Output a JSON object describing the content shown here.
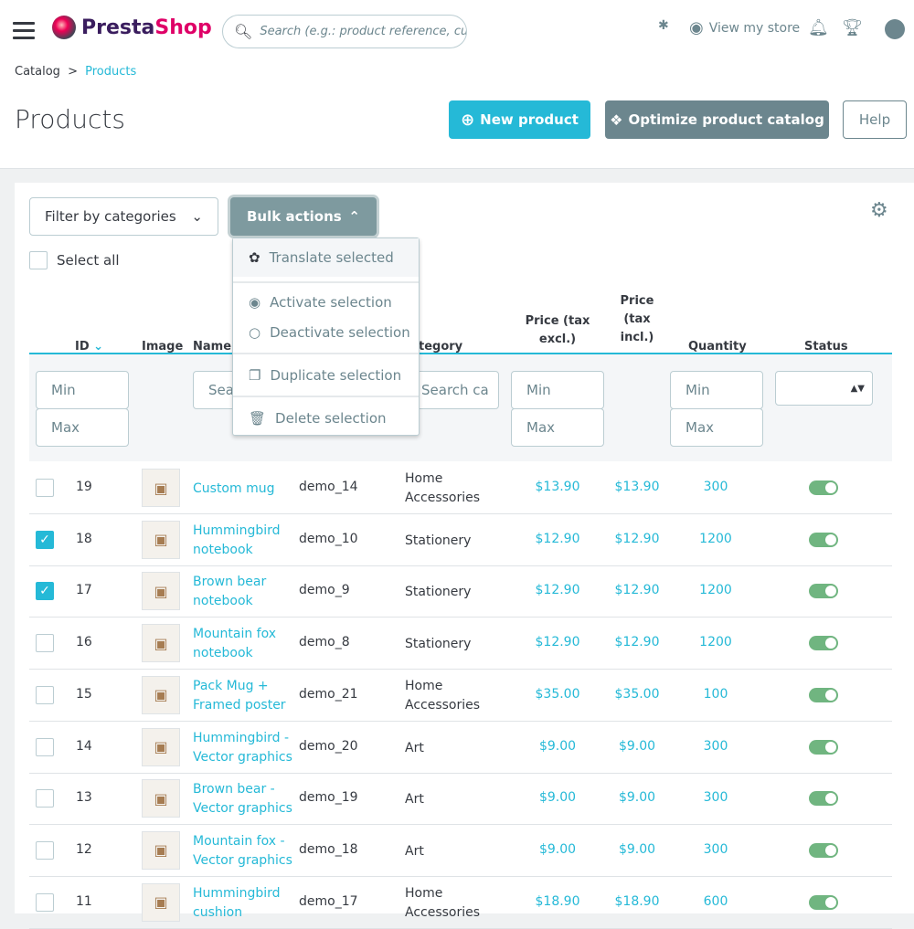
{
  "header": {
    "brand": "PrestaShop",
    "brand_part1": "Presta",
    "brand_part2": "Shop",
    "search_placeholder": "Search (e.g.: product reference, custon",
    "view_store": "View my store"
  },
  "breadcrumb": {
    "parent": "Catalog",
    "separator": ">",
    "current": "Products"
  },
  "page": {
    "title": "Products",
    "new_product": "New product",
    "optimize": "Optimize product catalog",
    "help": "Help"
  },
  "toolbar": {
    "filter_categories": "Filter by categories",
    "bulk_actions": "Bulk actions",
    "select_all": "Select all"
  },
  "bulk_menu": [
    "Translate selected",
    "Activate selection",
    "Deactivate selection",
    "Duplicate selection",
    "Delete selection"
  ],
  "columns": {
    "id": "ID",
    "image": "Image",
    "name": "Name",
    "category": "tegory",
    "price_excl": "Price (tax excl.)",
    "price_incl": "Price (tax incl.)",
    "quantity": "Quantity",
    "status": "Status"
  },
  "filters": {
    "min": "Min",
    "max": "Max",
    "name_search": "Sea",
    "category_search": "Search ca"
  },
  "colors": {
    "accent": "#25b9d7",
    "toggle_on": "#70b580",
    "bulk": "#7e9a9f"
  },
  "rows": [
    {
      "checked": false,
      "id": "19",
      "name": "Custom mug",
      "ref": "demo_14",
      "category": "Home Accessories",
      "excl": "$13.90",
      "incl": "$13.90",
      "qty": "300",
      "active": true
    },
    {
      "checked": true,
      "id": "18",
      "name": "Hummingbird notebook",
      "ref": "demo_10",
      "category": "Stationery",
      "excl": "$12.90",
      "incl": "$12.90",
      "qty": "1200",
      "active": true
    },
    {
      "checked": true,
      "id": "17",
      "name": "Brown bear notebook",
      "ref": "demo_9",
      "category": "Stationery",
      "excl": "$12.90",
      "incl": "$12.90",
      "qty": "1200",
      "active": true
    },
    {
      "checked": false,
      "id": "16",
      "name": "Mountain fox notebook",
      "ref": "demo_8",
      "category": "Stationery",
      "excl": "$12.90",
      "incl": "$12.90",
      "qty": "1200",
      "active": true
    },
    {
      "checked": false,
      "id": "15",
      "name": "Pack Mug + Framed poster",
      "ref": "demo_21",
      "category": "Home Accessories",
      "excl": "$35.00",
      "incl": "$35.00",
      "qty": "100",
      "active": true
    },
    {
      "checked": false,
      "id": "14",
      "name": "Hummingbird - Vector graphics",
      "ref": "demo_20",
      "category": "Art",
      "excl": "$9.00",
      "incl": "$9.00",
      "qty": "300",
      "active": true
    },
    {
      "checked": false,
      "id": "13",
      "name": "Brown bear - Vector graphics",
      "ref": "demo_19",
      "category": "Art",
      "excl": "$9.00",
      "incl": "$9.00",
      "qty": "300",
      "active": true
    },
    {
      "checked": false,
      "id": "12",
      "name": "Mountain fox - Vector graphics",
      "ref": "demo_18",
      "category": "Art",
      "excl": "$9.00",
      "incl": "$9.00",
      "qty": "300",
      "active": true
    },
    {
      "checked": false,
      "id": "11",
      "name": "Hummingbird cushion",
      "ref": "demo_17",
      "category": "Home Accessories",
      "excl": "$18.90",
      "incl": "$18.90",
      "qty": "600",
      "active": true
    }
  ]
}
